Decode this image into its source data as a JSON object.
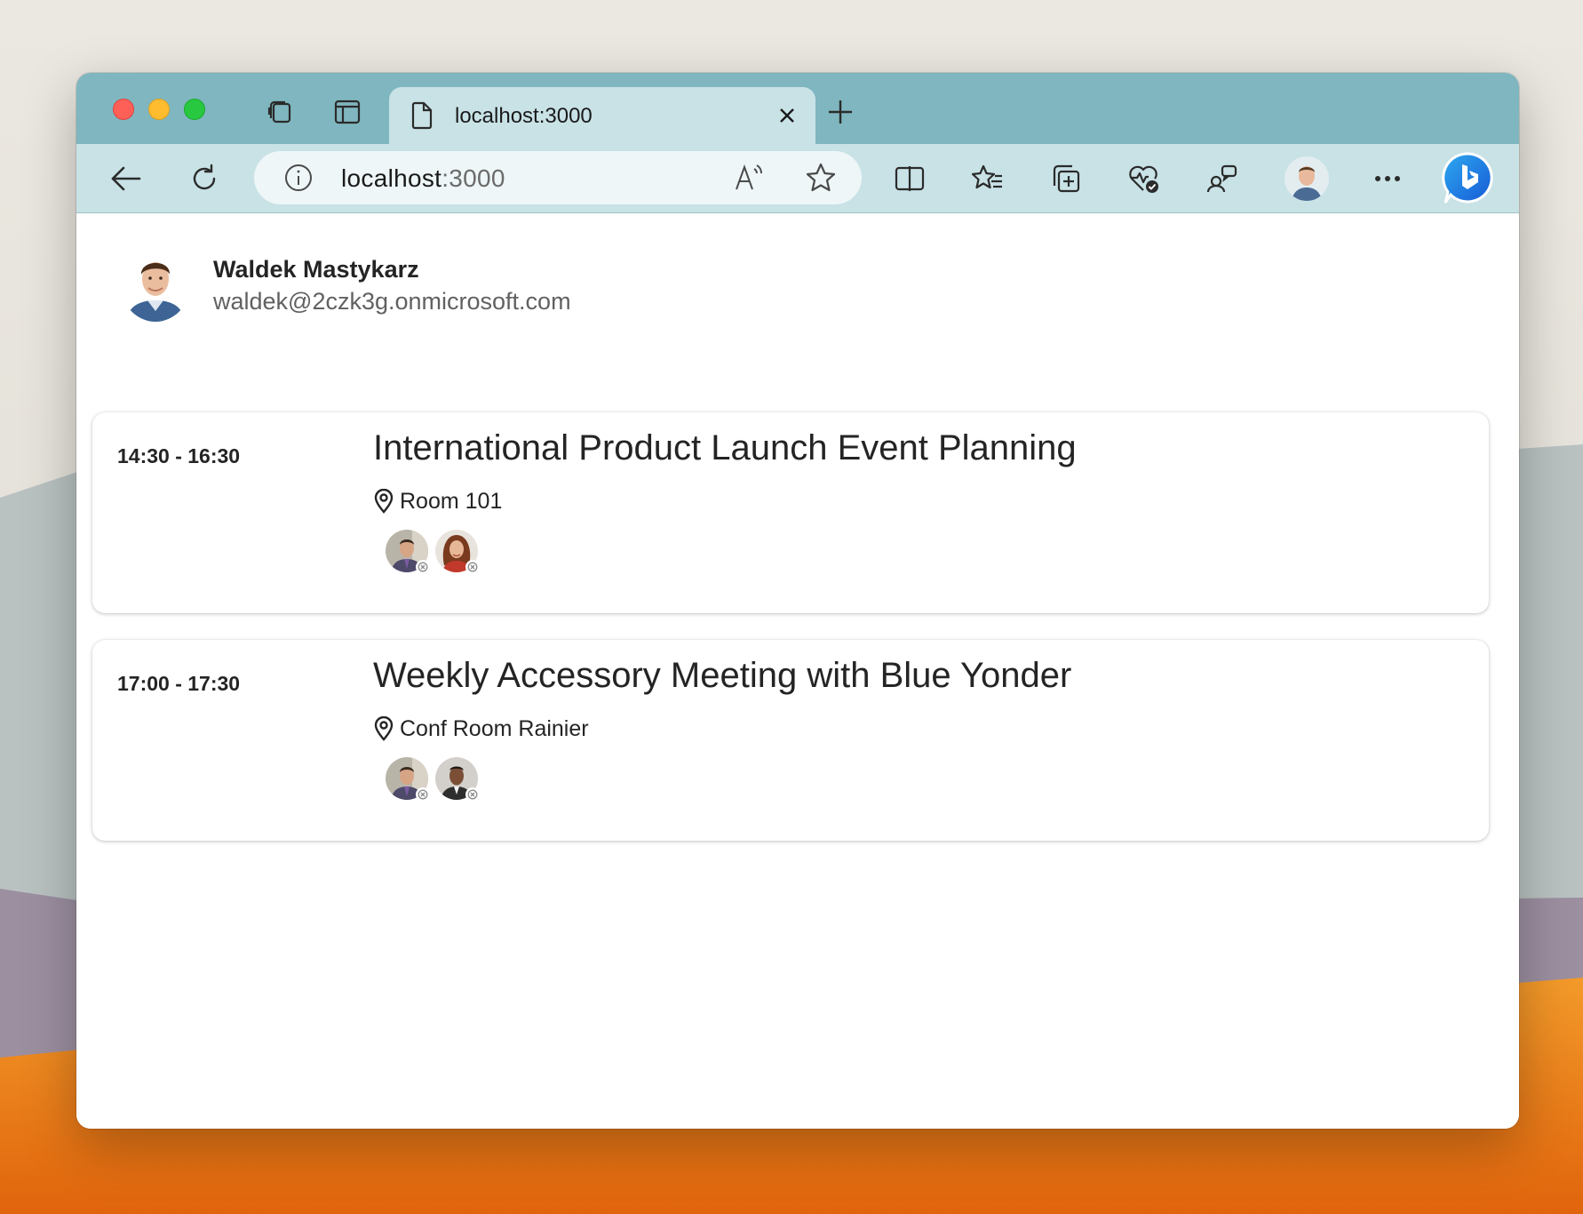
{
  "browser": {
    "tab_title": "localhost:3000",
    "url_host": "localhost",
    "url_port": ":3000",
    "titlebar_color": "#7fb6bf",
    "toolbar_color": "#c8e2e6"
  },
  "user": {
    "name": "Waldek Mastykarz",
    "email": "waldek@2czk3g.onmicrosoft.com"
  },
  "events": [
    {
      "time": "14:30 - 16:30",
      "subject": "International Product Launch Event Planning",
      "location": "Room 101",
      "attendees": [
        "attendee-man-photo",
        "attendee-woman-photo"
      ]
    },
    {
      "time": "17:00 - 17:30",
      "subject": "Weekly Accessory Meeting with Blue Yonder",
      "location": "Conf Room Rainier",
      "attendees": [
        "attendee-man-photo",
        "attendee-man-dark-photo"
      ]
    }
  ]
}
